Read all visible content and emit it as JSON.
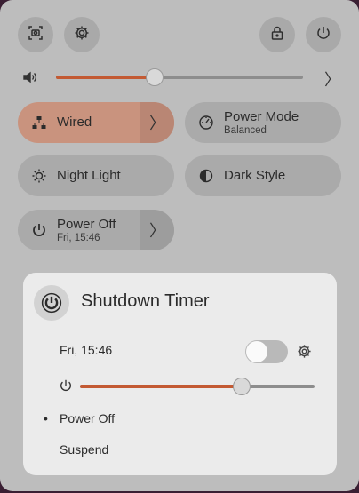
{
  "quick_settings": {
    "tiles": {
      "wired": {
        "label": "Wired"
      },
      "power_mode": {
        "label": "Power Mode",
        "subtitle": "Balanced"
      },
      "night_light": {
        "label": "Night Light"
      },
      "dark_style": {
        "label": "Dark Style"
      },
      "power_off": {
        "label": "Power Off",
        "subtitle": "Fri, 15:46"
      }
    },
    "volume": {
      "level": 0.4
    }
  },
  "shutdown_timer": {
    "title": "Shutdown Timer",
    "time": "Fri, 15:46",
    "enabled": false,
    "slider_level": 0.69,
    "options": [
      {
        "label": "Power Off",
        "selected": true
      },
      {
        "label": "Suspend",
        "selected": false
      }
    ],
    "bullet": "•"
  },
  "colors": {
    "accent": "#c35a33"
  }
}
